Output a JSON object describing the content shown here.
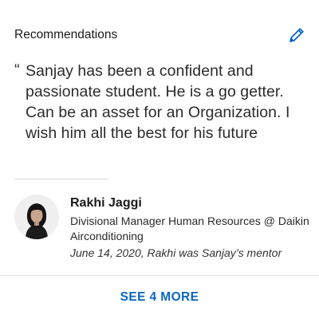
{
  "section": {
    "title": "Recommendations",
    "edit_icon": "pencil-icon"
  },
  "recommendation": {
    "quote_mark": "“",
    "text": "Sanjay has been a confident and passionate student. He is a go getter. Can be an asset for an Organization. I wish him all the best for his future",
    "recommender": {
      "name": "Rakhi Jaggi",
      "headline": "Divisional Manager Human Resources @ Daikin Airconditioning",
      "meta": "June 14, 2020, Rakhi was Sanjay’s mentor"
    }
  },
  "see_more": {
    "label": "SEE 4 MORE"
  },
  "colors": {
    "accent": "#0a66c2",
    "text": "#2b2b2b",
    "divider": "#d9d9d9"
  }
}
